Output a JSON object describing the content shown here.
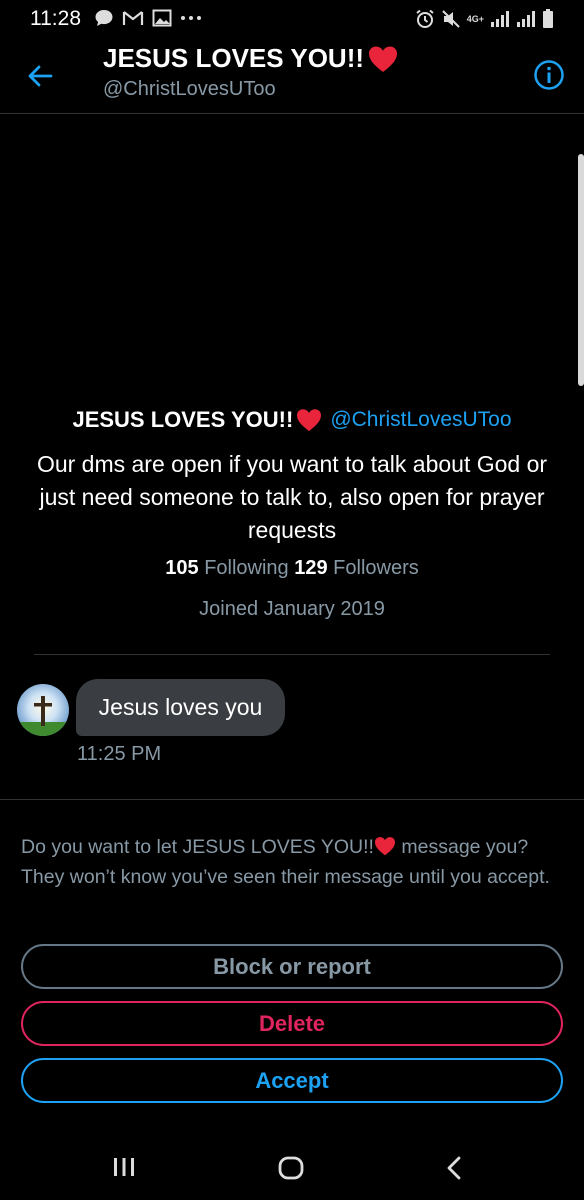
{
  "status_bar": {
    "time": "11:28",
    "icons": [
      "chat-bubble-icon",
      "gmail-icon",
      "gallery-icon",
      "more-dots-icon",
      "alarm-icon",
      "mute-icon",
      "4g-data-icon",
      "signal-icon",
      "signal-icon-2",
      "battery-icon"
    ],
    "network_label": "4G+"
  },
  "header": {
    "title": "JESUS LOVES YOU!!",
    "handle": "@ChristLovesUToo",
    "back_icon": "back-arrow-icon",
    "info_icon": "info-icon"
  },
  "profile": {
    "name": "JESUS LOVES YOU!!",
    "handle": "@ChristLovesUToo",
    "bio": "Our dms are open if you want to talk about God or just need someone to talk to, also open for prayer requests",
    "following_count": "105",
    "following_label": "Following",
    "followers_count": "129",
    "followers_label": "Followers",
    "joined": "Joined January 2019"
  },
  "message": {
    "text": "Jesus loves you",
    "time": "11:25 PM"
  },
  "request": {
    "prompt_prefix": "Do you want to let JESUS LOVES YOU!!",
    "prompt_suffix": " message you? They won’t know you’ve seen their message until you accept."
  },
  "actions": {
    "block_label": "Block or report",
    "delete_label": "Delete",
    "accept_label": "Accept"
  },
  "colors": {
    "accent": "#1da1f2",
    "danger": "#e0245e",
    "secondary_text": "#8899a6",
    "heart": "#e8253b"
  }
}
